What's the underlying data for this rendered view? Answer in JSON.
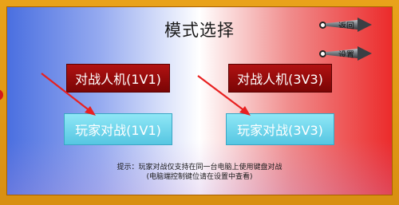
{
  "title": "模式选择",
  "nav": {
    "back_label": "返回",
    "settings_label": "设置"
  },
  "modes": {
    "pve_1v1": "对战人机(1V1)",
    "pve_3v3": "对战人机(3V3)",
    "pvp_1v1": "玩家对战(1V1)",
    "pvp_3v3": "玩家对战(3V3)"
  },
  "hint": {
    "line1": "提示：玩家对战仅支持在同一台电脑上使用键盘对战",
    "line2": "(电脑端控制键位请在设置中查看)"
  },
  "colors": {
    "frame": "#e9a21a",
    "panel_left": "#4a6fe0",
    "panel_right": "#ec2b2b",
    "dark_button": "#9a0c0c",
    "light_button": "#6dd3ea",
    "arrow": "#e82020"
  },
  "icons": {
    "back": "kunai-icon",
    "settings": "kunai-icon",
    "pointer": "red-arrow-icon"
  }
}
